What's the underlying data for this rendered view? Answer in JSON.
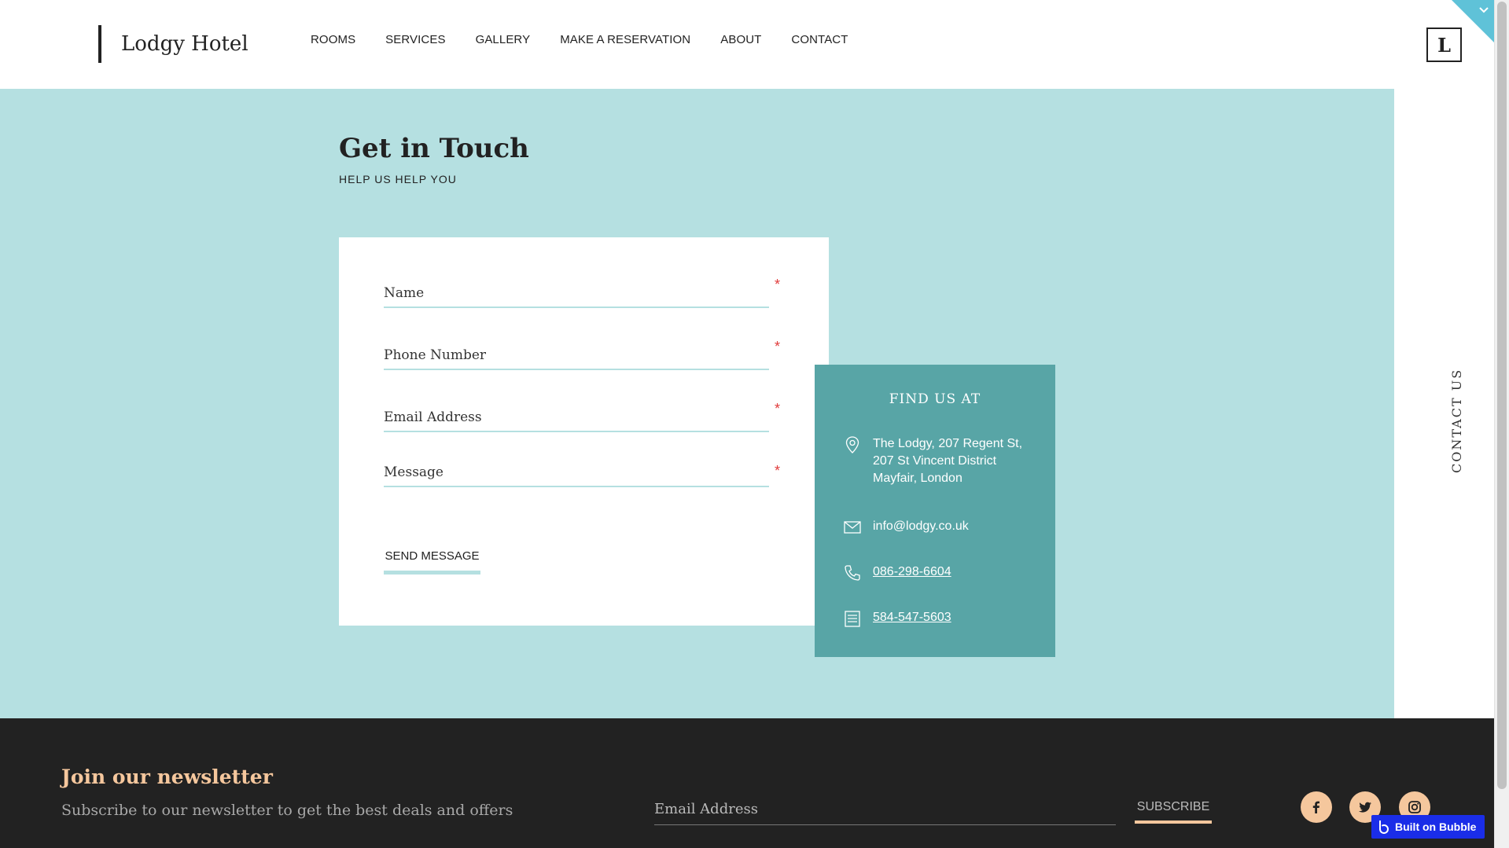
{
  "header": {
    "brand": "Lodgy Hotel",
    "nav": [
      "ROOMS",
      "SERVICES",
      "GALLERY",
      "MAKE A RESERVATION",
      "ABOUT",
      "CONTACT"
    ],
    "logo_letter": "L"
  },
  "main": {
    "title": "Get in Touch",
    "subtitle": "HELP US HELP YOU",
    "form": {
      "name_placeholder": "Name",
      "phone_placeholder": "Phone Number",
      "email_placeholder": "Email Address",
      "message_placeholder": "Message",
      "required_mark": "*",
      "send_label": "SEND MESSAGE"
    },
    "find_us": {
      "title": "FIND US AT",
      "address_line1": "The Lodgy, 207 Regent St,",
      "address_line2": "207 St Vincent District",
      "address_line3": "Mayfair, London",
      "email": "info@lodgy.co.uk",
      "phone": "086-298-6604",
      "fax": "584-547-5603"
    }
  },
  "side": {
    "label": "CONTACT US"
  },
  "footer": {
    "newsletter_title": "Join our newsletter",
    "newsletter_subtitle": "Subscribe to our newsletter to get the best deals and offers",
    "email_placeholder": "Email Address",
    "subscribe_label": "SUBSCRIBE",
    "social": [
      "facebook-icon",
      "twitter-icon",
      "instagram-icon"
    ]
  },
  "badge": {
    "label": "Built on Bubble"
  },
  "colors": {
    "teal_light": "#b5e0e1",
    "teal_dark": "#58a5a6",
    "footer_bg": "#222222",
    "accent_peach": "#f5c79d",
    "required_red": "#e03b3b",
    "bubble_blue": "#1a2de8"
  }
}
